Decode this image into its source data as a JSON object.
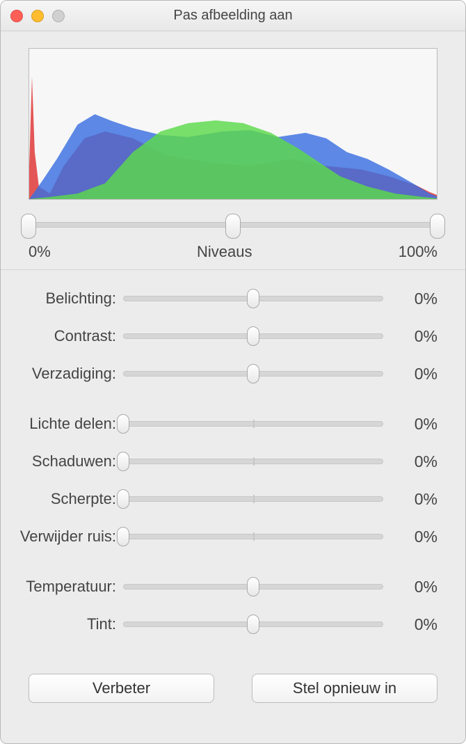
{
  "window": {
    "title": "Pas afbeelding aan"
  },
  "histogram": {
    "levels_label": "Niveaus",
    "left_label": "0%",
    "right_label": "100%",
    "handles": {
      "black": 0,
      "mid": 50,
      "white": 100
    }
  },
  "sliders": {
    "group1": [
      {
        "key": "exposure",
        "label": "Belichting:",
        "value": "0%",
        "pos": 50,
        "tick": null
      },
      {
        "key": "contrast",
        "label": "Contrast:",
        "value": "0%",
        "pos": 50,
        "tick": null
      },
      {
        "key": "saturation",
        "label": "Verzadiging:",
        "value": "0%",
        "pos": 50,
        "tick": null
      }
    ],
    "group2": [
      {
        "key": "highlights",
        "label": "Lichte delen:",
        "value": "0%",
        "pos": 0,
        "tick": 50
      },
      {
        "key": "shadows",
        "label": "Schaduwen:",
        "value": "0%",
        "pos": 0,
        "tick": 50
      },
      {
        "key": "sharpen",
        "label": "Scherpte:",
        "value": "0%",
        "pos": 0,
        "tick": 50
      },
      {
        "key": "denoise",
        "label": "Verwijder ruis:",
        "value": "0%",
        "pos": 0,
        "tick": 50
      }
    ],
    "group3": [
      {
        "key": "temperature",
        "label": "Temperatuur:",
        "value": "0%",
        "pos": 50,
        "tick": null
      },
      {
        "key": "tint",
        "label": "Tint:",
        "value": "0%",
        "pos": 50,
        "tick": null
      }
    ]
  },
  "buttons": {
    "enhance": "Verbeter",
    "reset": "Stel opnieuw in"
  }
}
